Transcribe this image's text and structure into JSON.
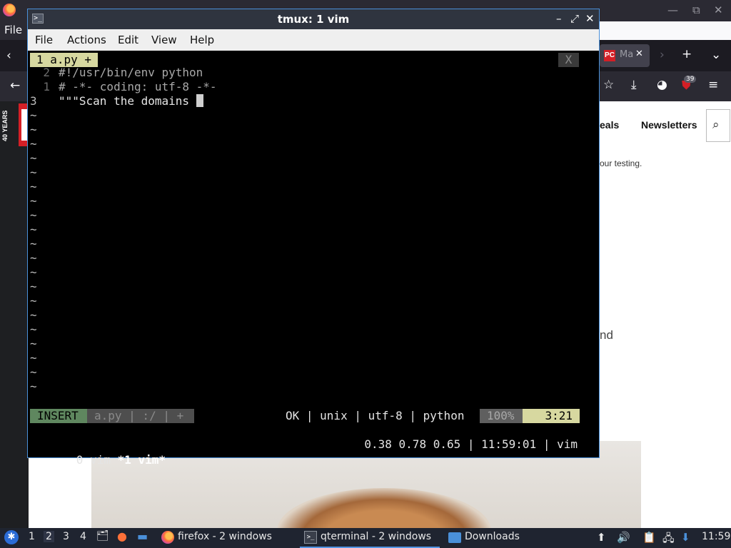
{
  "firefox": {
    "menu_file": "File",
    "tab_label": "Ma",
    "tab_close": "✕",
    "page_deals": "eals",
    "page_newsletters": "Newsletters",
    "page_testing": "our testing.",
    "page_nd": "nd",
    "sidebar_years": "40 YEARS",
    "badge_count": "39",
    "pc_logo": "PC"
  },
  "terminal": {
    "title": "tmux: 1 vim",
    "menu": [
      "File",
      "Actions",
      "Edit",
      "View",
      "Help"
    ],
    "vim": {
      "buffer_tab": "1 a.py +",
      "buffer_close": "X",
      "lines": [
        {
          "num": "2",
          "text": "#!/usr/bin/env python"
        },
        {
          "num": "1",
          "text": "# -*- coding: utf-8 -*-"
        },
        {
          "num": "3",
          "text": "\"\"\"Scan the domains "
        }
      ],
      "tilde": "~",
      "statusline": {
        "mode": "INSERT",
        "file": "a.py | :/ | +",
        "info": "OK | unix | utf-8 | python",
        "percent": "100%",
        "position": "3:21"
      }
    },
    "tmux": {
      "window0": "0 vim",
      "window1": "*1 vim*",
      "right": "0.38 0.78 0.65 | 11:59:01 | vim"
    }
  },
  "taskbar": {
    "workspaces": [
      "1",
      "2",
      "3",
      "4"
    ],
    "active_workspace": "2",
    "tasks": [
      {
        "label": "firefox - 2 windows",
        "icon": "firefox-icon"
      },
      {
        "label": "qterminal - 2 windows",
        "icon": "terminal-icon"
      },
      {
        "label": "Downloads",
        "icon": "folder-icon"
      }
    ],
    "clock": "11:59"
  },
  "colors": {
    "vim_tab": "#d7d8a0",
    "vim_insert": "#5f875f",
    "accent": "#5294e2"
  }
}
